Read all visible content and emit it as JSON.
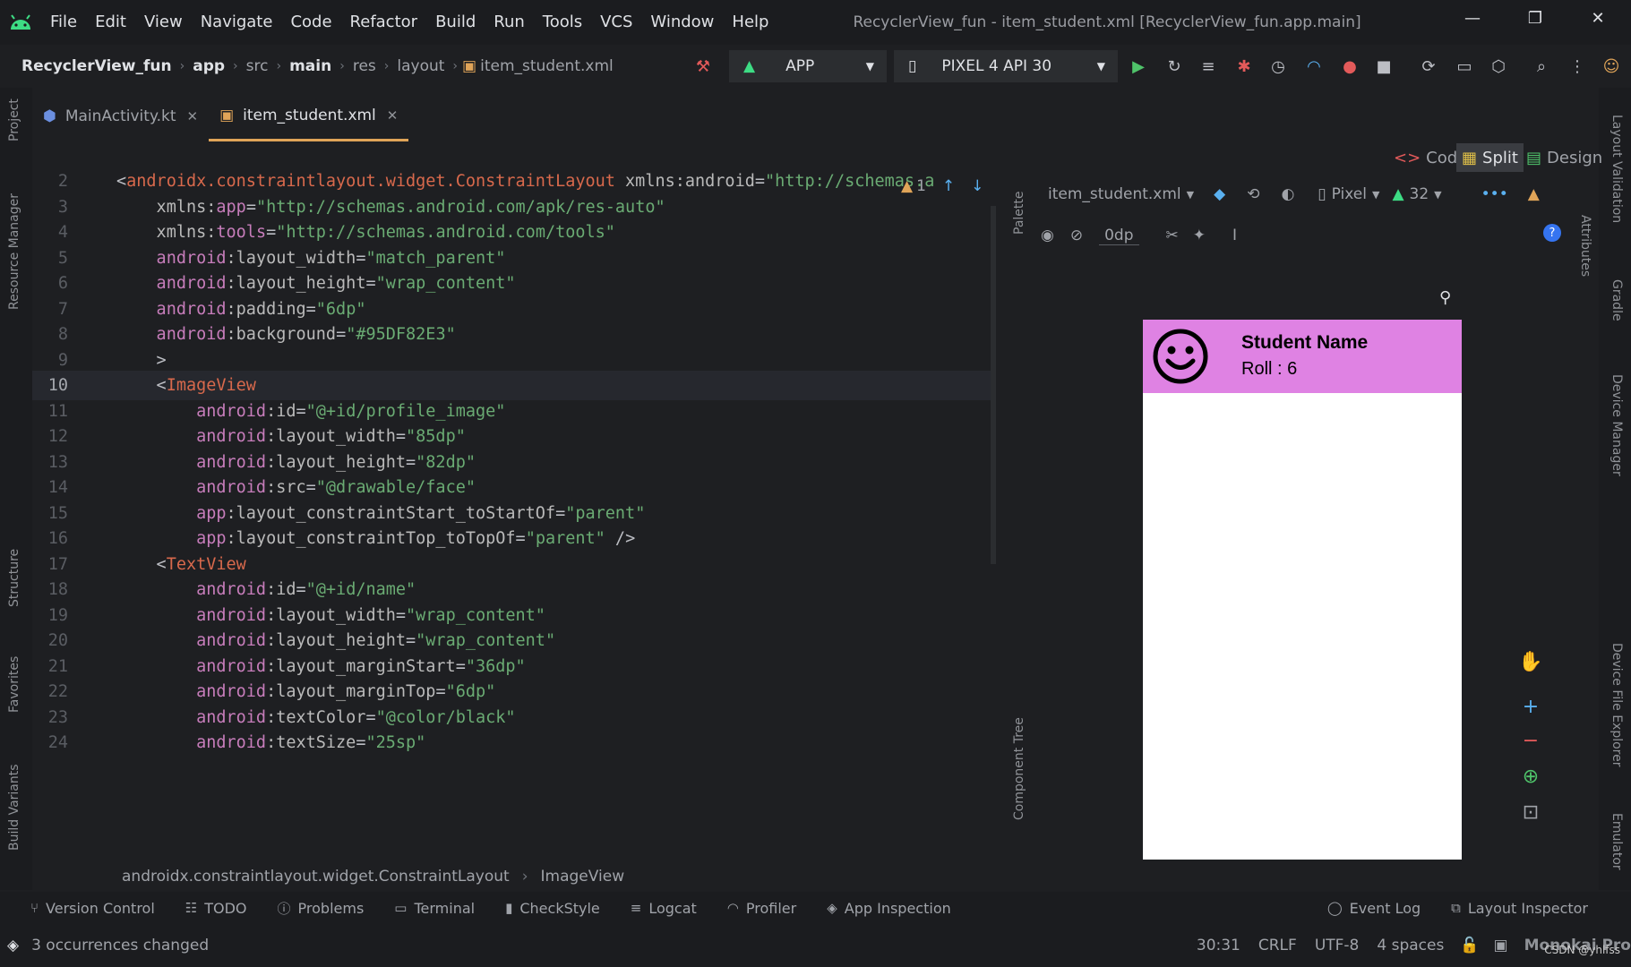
{
  "menubar": {
    "items": [
      "File",
      "Edit",
      "View",
      "Navigate",
      "Code",
      "Refactor",
      "Build",
      "Run",
      "Tools",
      "VCS",
      "Window",
      "Help"
    ],
    "title": "RecyclerView_fun - item_student.xml [RecyclerView_fun.app.main]"
  },
  "nav": {
    "crumbs": [
      "RecyclerView_fun",
      "app",
      "src",
      "main",
      "res",
      "layout",
      "item_student.xml"
    ],
    "run_config": "APP",
    "device": "PIXEL 4 API 30"
  },
  "tabs": [
    {
      "label": "MainActivity.kt"
    },
    {
      "label": "item_student.xml"
    }
  ],
  "editor": {
    "inspection_count": "1",
    "lines": [
      {
        "n": "2",
        "parts": [
          [
            "brkt",
            "<"
          ],
          [
            "tagname",
            "androidx.constraintlayout.widget.ConstraintLayout"
          ],
          [
            "attr",
            " xmlns:"
          ],
          [
            "attr",
            "android"
          ],
          [
            "brkt",
            "="
          ],
          [
            "str",
            "\"http://schemas.a"
          ]
        ]
      },
      {
        "n": "3",
        "parts": [
          [
            "attr",
            "    xmlns:"
          ],
          [
            "ns",
            "app"
          ],
          [
            "brkt",
            "="
          ],
          [
            "str",
            "\"http://schemas.android.com/apk/res-auto\""
          ]
        ]
      },
      {
        "n": "4",
        "parts": [
          [
            "attr",
            "    xmlns:"
          ],
          [
            "ns",
            "tools"
          ],
          [
            "brkt",
            "="
          ],
          [
            "str",
            "\"http://schemas.android.com/tools\""
          ]
        ]
      },
      {
        "n": "5",
        "parts": [
          [
            "ns",
            "    android"
          ],
          [
            "attr",
            ":layout_width"
          ],
          [
            "brkt",
            "="
          ],
          [
            "str",
            "\"match_parent\""
          ]
        ]
      },
      {
        "n": "6",
        "parts": [
          [
            "ns",
            "    android"
          ],
          [
            "attr",
            ":layout_height"
          ],
          [
            "brkt",
            "="
          ],
          [
            "str",
            "\"wrap_content\""
          ]
        ]
      },
      {
        "n": "7",
        "parts": [
          [
            "ns",
            "    android"
          ],
          [
            "attr",
            ":padding"
          ],
          [
            "brkt",
            "="
          ],
          [
            "str",
            "\"6dp\""
          ]
        ]
      },
      {
        "n": "8",
        "parts": [
          [
            "ns",
            "    android"
          ],
          [
            "attr",
            ":background"
          ],
          [
            "brkt",
            "="
          ],
          [
            "str",
            "\"#95DF82E3\""
          ]
        ]
      },
      {
        "n": "9",
        "parts": [
          [
            "brkt",
            "    >"
          ]
        ]
      },
      {
        "n": "10",
        "parts": [
          [
            "brkt",
            "    <"
          ],
          [
            "tagname",
            "ImageView"
          ]
        ]
      },
      {
        "n": "11",
        "parts": [
          [
            "ns",
            "        android"
          ],
          [
            "attr",
            ":id"
          ],
          [
            "brkt",
            "="
          ],
          [
            "str",
            "\"@+id/profile_image\""
          ]
        ]
      },
      {
        "n": "12",
        "parts": [
          [
            "ns",
            "        android"
          ],
          [
            "attr",
            ":layout_width"
          ],
          [
            "brkt",
            "="
          ],
          [
            "str",
            "\"85dp\""
          ]
        ]
      },
      {
        "n": "13",
        "parts": [
          [
            "ns",
            "        android"
          ],
          [
            "attr",
            ":layout_height"
          ],
          [
            "brkt",
            "="
          ],
          [
            "str",
            "\"82dp\""
          ]
        ]
      },
      {
        "n": "14",
        "parts": [
          [
            "ns",
            "        android"
          ],
          [
            "attr",
            ":src"
          ],
          [
            "brkt",
            "="
          ],
          [
            "str",
            "\"@drawable/face\""
          ]
        ]
      },
      {
        "n": "15",
        "parts": [
          [
            "ns",
            "        app"
          ],
          [
            "attr",
            ":layout_constraintStart_toStartOf"
          ],
          [
            "brkt",
            "="
          ],
          [
            "str",
            "\"parent\""
          ]
        ]
      },
      {
        "n": "16",
        "parts": [
          [
            "ns",
            "        app"
          ],
          [
            "attr",
            ":layout_constraintTop_toTopOf"
          ],
          [
            "brkt",
            "="
          ],
          [
            "str",
            "\"parent\""
          ],
          [
            "brkt",
            " />"
          ]
        ]
      },
      {
        "n": "17",
        "parts": [
          [
            "brkt",
            "    <"
          ],
          [
            "tagname",
            "TextView"
          ]
        ]
      },
      {
        "n": "18",
        "parts": [
          [
            "ns",
            "        android"
          ],
          [
            "attr",
            ":id"
          ],
          [
            "brkt",
            "="
          ],
          [
            "str",
            "\"@+id/name\""
          ]
        ]
      },
      {
        "n": "19",
        "parts": [
          [
            "ns",
            "        android"
          ],
          [
            "attr",
            ":layout_width"
          ],
          [
            "brkt",
            "="
          ],
          [
            "str",
            "\"wrap_content\""
          ]
        ]
      },
      {
        "n": "20",
        "parts": [
          [
            "ns",
            "        android"
          ],
          [
            "attr",
            ":layout_height"
          ],
          [
            "brkt",
            "="
          ],
          [
            "str",
            "\"wrap_content\""
          ]
        ]
      },
      {
        "n": "21",
        "parts": [
          [
            "ns",
            "        android"
          ],
          [
            "attr",
            ":layout_marginStart"
          ],
          [
            "brkt",
            "="
          ],
          [
            "str",
            "\"36dp\""
          ]
        ]
      },
      {
        "n": "22",
        "parts": [
          [
            "ns",
            "        android"
          ],
          [
            "attr",
            ":layout_marginTop"
          ],
          [
            "brkt",
            "="
          ],
          [
            "str",
            "\"6dp\""
          ]
        ]
      },
      {
        "n": "23",
        "parts": [
          [
            "ns",
            "        android"
          ],
          [
            "attr",
            ":textColor"
          ],
          [
            "brkt",
            "="
          ],
          [
            "str",
            "\"@color/black\""
          ]
        ]
      },
      {
        "n": "24",
        "parts": [
          [
            "ns",
            "        android"
          ],
          [
            "attr",
            ":textSize"
          ],
          [
            "brkt",
            "="
          ],
          [
            "str",
            "\"25sp\""
          ]
        ]
      }
    ]
  },
  "editor_breadcrumb": {
    "root": "androidx.constraintlayout.widget.ConstraintLayout",
    "leaf": "ImageView"
  },
  "view_modes": {
    "code": "Code",
    "split": "Split",
    "design": "Design"
  },
  "design_toolbar": {
    "file": "item_student.xml",
    "device": "Pixel",
    "api": "32",
    "margin": "0dp"
  },
  "preview": {
    "name": "Student Name",
    "roll": "Roll : 6",
    "background": "#df82e3"
  },
  "left_tabs": {
    "project": "Project",
    "resource_manager": "Resource Manager",
    "structure": "Structure",
    "favorites": "Favorites",
    "build_variants": "Build Variants"
  },
  "right_tabs": {
    "layout_validation": "Layout Validation",
    "gradle": "Gradle",
    "device_manager": "Device Manager",
    "device_file_explorer": "Device File Explorer",
    "emulator": "Emulator",
    "attributes": "Attributes"
  },
  "mid_tabs": {
    "palette": "Palette",
    "component_tree": "Component Tree"
  },
  "bottom_tools": [
    "Version Control",
    "TODO",
    "Problems",
    "Terminal",
    "CheckStyle",
    "Logcat",
    "Profiler",
    "App Inspection"
  ],
  "bottom_right_tools": [
    "Event Log",
    "Layout Inspector"
  ],
  "status": {
    "message": "3 occurrences changed",
    "position": "30:31",
    "line_sep": "CRLF",
    "encoding": "UTF-8",
    "indent": "4 spaces",
    "theme": "Monokai Pro",
    "watermark": "CSDN @yhlfss"
  }
}
